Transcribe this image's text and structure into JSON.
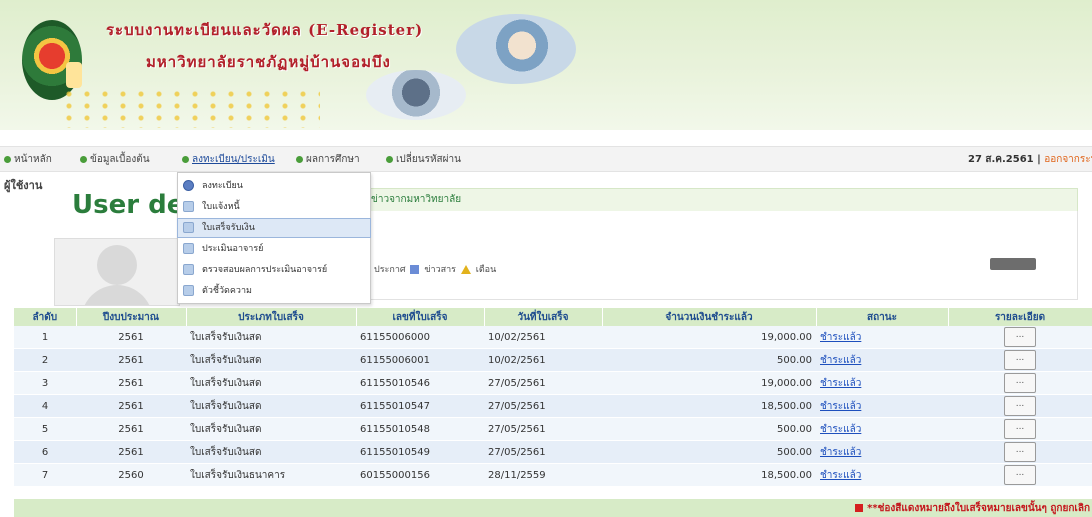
{
  "header": {
    "title_line1": "ระบบงานทะเบียนและวัดผล (E-Register)",
    "title_line2": "มหาวิทยาลัยราชภัฏหมู่บ้านจอมบึง"
  },
  "nav": {
    "items": [
      {
        "label": "หน้าหลัก"
      },
      {
        "label": "ข้อมูลเบื้องต้น"
      },
      {
        "label": "ลงทะเบียน/ประเมิน"
      },
      {
        "label": "ผลการศึกษา"
      },
      {
        "label": "เปลี่ยนรหัสผ่าน"
      }
    ],
    "date": "27 ส.ค.2561 |",
    "logout": "ออกจากระบบ"
  },
  "page": {
    "label": "ผู้ใช้งาน",
    "heading": "User de",
    "info_bar": "ข่าวจากมหาวิทยาลัย",
    "msg_text": "ประกาศ",
    "msg_news": "ข่าวสาร",
    "msg_warn": "เตือน"
  },
  "dropdown": {
    "items": [
      {
        "label": "ลงทะเบียน"
      },
      {
        "label": "ใบแจ้งหนี้"
      },
      {
        "label": "ใบเสร็จรับเงิน"
      },
      {
        "label": "ประเมินอาจารย์"
      },
      {
        "label": "ตรวจสอบผลการประเมินอาจารย์"
      },
      {
        "label": "ตัวชี้วัดความ"
      }
    ]
  },
  "table": {
    "headers": [
      "ลำดับ",
      "ปีงบประมาณ",
      "ประเภทใบเสร็จ",
      "เลขที่ใบเสร็จ",
      "วันที่ใบเสร็จ",
      "จำนวนเงินชำระแล้ว",
      "สถานะ",
      "รายละเอียด"
    ],
    "rows": [
      {
        "no": "1",
        "year": "2561",
        "type": "ใบเสร็จรับเงินสด",
        "receipt": "61155006000",
        "date": "10/02/2561",
        "amount": "19,000.00",
        "status": "ชำระแล้ว",
        "detail": "..."
      },
      {
        "no": "2",
        "year": "2561",
        "type": "ใบเสร็จรับเงินสด",
        "receipt": "61155006001",
        "date": "10/02/2561",
        "amount": "500.00",
        "status": "ชำระแล้ว",
        "detail": "..."
      },
      {
        "no": "3",
        "year": "2561",
        "type": "ใบเสร็จรับเงินสด",
        "receipt": "61155010546",
        "date": "27/05/2561",
        "amount": "19,000.00",
        "status": "ชำระแล้ว",
        "detail": "..."
      },
      {
        "no": "4",
        "year": "2561",
        "type": "ใบเสร็จรับเงินสด",
        "receipt": "61155010547",
        "date": "27/05/2561",
        "amount": "18,500.00",
        "status": "ชำระแล้ว",
        "detail": "..."
      },
      {
        "no": "5",
        "year": "2561",
        "type": "ใบเสร็จรับเงินสด",
        "receipt": "61155010548",
        "date": "27/05/2561",
        "amount": "500.00",
        "status": "ชำระแล้ว",
        "detail": "..."
      },
      {
        "no": "6",
        "year": "2561",
        "type": "ใบเสร็จรับเงินสด",
        "receipt": "61155010549",
        "date": "27/05/2561",
        "amount": "500.00",
        "status": "ชำระแล้ว",
        "detail": "..."
      },
      {
        "no": "7",
        "year": "2560",
        "type": "ใบเสร็จรับเงินธนาคาร",
        "receipt": "60155000156",
        "date": "28/11/2559",
        "amount": "18,500.00",
        "status": "ชำระแล้ว",
        "detail": "..."
      }
    ],
    "footer_note": "**ช่องสีแดงหมายถึงใบเสร็จหมายเลขนั้นๆ ถูกยกเลิก"
  },
  "colors": {
    "header_green": "#d7ebc7",
    "heading_green": "#2b7d3c",
    "link_blue": "#1d4fbd",
    "alert_red": "#c4161c"
  }
}
